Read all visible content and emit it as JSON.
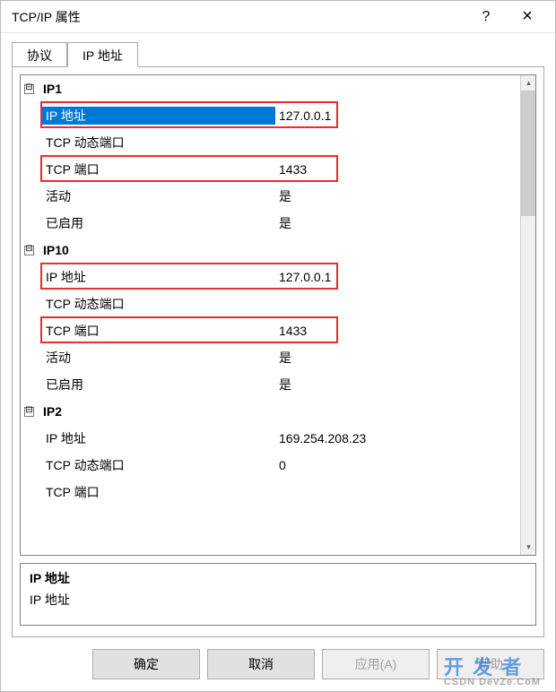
{
  "window": {
    "title": "TCP/IP 属性",
    "help": "?",
    "close": "×"
  },
  "tabs": {
    "protocol": "协议",
    "ip_address": "IP 地址"
  },
  "collapse_glyph": "⊟",
  "groups": [
    {
      "title": "IP1",
      "rows": [
        {
          "label": "IP 地址",
          "value": "127.0.0.1",
          "selected": true,
          "boxed": true
        },
        {
          "label": "TCP 动态端口",
          "value": ""
        },
        {
          "label": "TCP 端口",
          "value": "1433",
          "boxed": true
        },
        {
          "label": "活动",
          "value": "是"
        },
        {
          "label": "已启用",
          "value": "是"
        }
      ]
    },
    {
      "title": "IP10",
      "rows": [
        {
          "label": "IP 地址",
          "value": "127.0.0.1",
          "boxed": true
        },
        {
          "label": "TCP 动态端口",
          "value": ""
        },
        {
          "label": "TCP 端口",
          "value": "1433",
          "boxed": true
        },
        {
          "label": "活动",
          "value": "是"
        },
        {
          "label": "已启用",
          "value": "是"
        }
      ]
    },
    {
      "title": "IP2",
      "rows": [
        {
          "label": "IP 地址",
          "value": "169.254.208.23"
        },
        {
          "label": "TCP 动态端口",
          "value": "0"
        },
        {
          "label": "TCP 端口",
          "value": ""
        }
      ]
    }
  ],
  "description": {
    "title": "IP 地址",
    "body": "IP 地址"
  },
  "buttons": {
    "ok": "确定",
    "cancel": "取消",
    "apply": "应用(A)",
    "help": "帮助"
  },
  "watermark": {
    "cn": "开 发 者",
    "en": "CSDN DevZe.CoM"
  }
}
